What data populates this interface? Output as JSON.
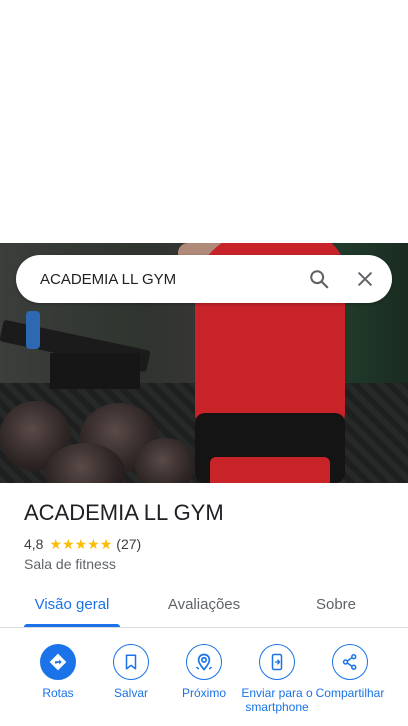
{
  "search": {
    "query": "ACADEMIA LL GYM",
    "search_icon": "search-icon",
    "clear_icon": "close-icon"
  },
  "place": {
    "name": "ACADEMIA LL GYM",
    "rating": "4,8",
    "stars": 5,
    "review_count": "(27)",
    "category": "Sala de fitness"
  },
  "tabs": [
    {
      "label": "Visão geral",
      "active": true
    },
    {
      "label": "Avaliações",
      "active": false
    },
    {
      "label": "Sobre",
      "active": false
    }
  ],
  "actions": [
    {
      "label": "Rotas",
      "icon": "directions-icon"
    },
    {
      "label": "Salvar",
      "icon": "bookmark-icon"
    },
    {
      "label": "Próximo",
      "icon": "nearby-icon"
    },
    {
      "label": "Enviar para o smartphone",
      "icon": "send-to-phone-icon"
    },
    {
      "label": "Compartilhar",
      "icon": "share-icon"
    }
  ],
  "colors": {
    "accent": "#1a73e8",
    "star": "#fbbc04",
    "text_primary": "#202124",
    "text_secondary": "#5f6368"
  }
}
